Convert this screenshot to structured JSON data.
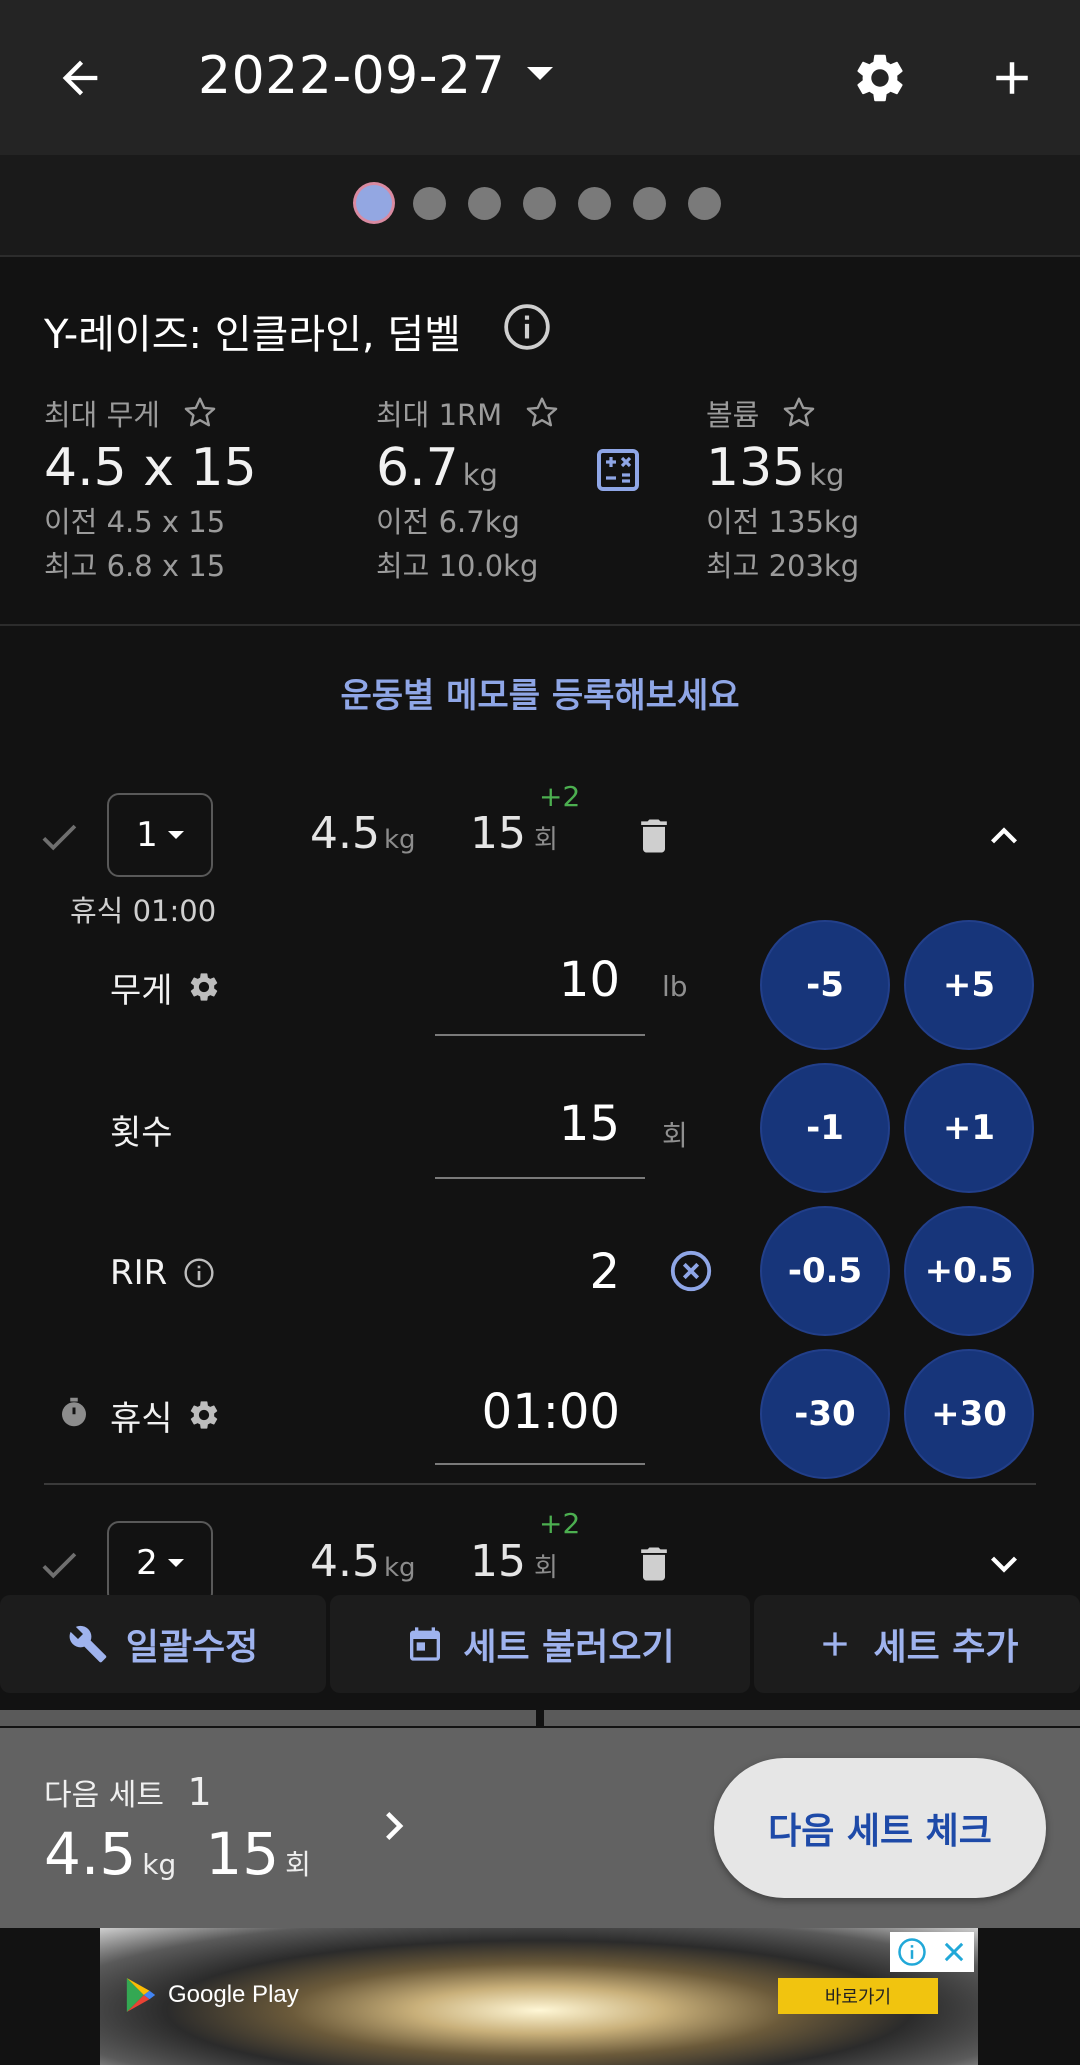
{
  "header": {
    "date": "2022-09-27",
    "back_icon": "arrow-left-icon",
    "settings_icon": "gear-icon",
    "add_icon": "plus-icon"
  },
  "pager": {
    "total": 7,
    "active_index": 0
  },
  "exercise": {
    "name": "Y-레이즈: 인클라인, 덤벨",
    "stats": [
      {
        "label": "최대 무게",
        "value": "4.5 x 15",
        "unit": "",
        "prev": "이전 4.5 x 15",
        "best": "최고 6.8 x 15"
      },
      {
        "label": "최대 1RM",
        "value": "6.7",
        "unit": "kg",
        "prev": "이전 6.7kg",
        "best": "최고 10.0kg"
      },
      {
        "label": "볼륨",
        "value": "135",
        "unit": "kg",
        "prev": "이전 135kg",
        "best": "최고 203kg"
      }
    ],
    "memo_prompt": "운동별 메모를 등록해보세요"
  },
  "sets": [
    {
      "number": "1",
      "weight": "4.5",
      "weight_unit": "kg",
      "reps": "15",
      "reps_unit": "회",
      "rir_badge": "+2",
      "rest_caption": "휴식 01:00",
      "expanded": true
    },
    {
      "number": "2",
      "weight": "4.5",
      "weight_unit": "kg",
      "reps": "15",
      "reps_unit": "회",
      "rir_badge": "+2",
      "expanded": false
    }
  ],
  "editor": {
    "weight": {
      "label": "무게",
      "value": "10",
      "unit": "lb",
      "dec": "-5",
      "inc": "+5"
    },
    "reps": {
      "label": "횟수",
      "value": "15",
      "unit": "회",
      "dec": "-1",
      "inc": "+1"
    },
    "rir": {
      "label": "RIR",
      "value": "2",
      "dec": "-0.5",
      "inc": "+0.5"
    },
    "rest": {
      "label": "휴식",
      "value": "01:00",
      "dec": "-30",
      "inc": "+30"
    }
  },
  "actions": {
    "bulk_edit": "일괄수정",
    "load_sets": "세트 불러오기",
    "add_set": "세트 추가"
  },
  "next_set": {
    "label": "다음 세트",
    "number": "1",
    "weight": "4.5",
    "weight_unit": "kg",
    "reps": "15",
    "reps_unit": "회",
    "button": "다음 세트 체크"
  },
  "ad": {
    "store": "Google Play",
    "cta": "바로가기"
  },
  "colors": {
    "accent": "#8fa6e6",
    "stepper": "#17357a",
    "positive": "#4caf50"
  }
}
